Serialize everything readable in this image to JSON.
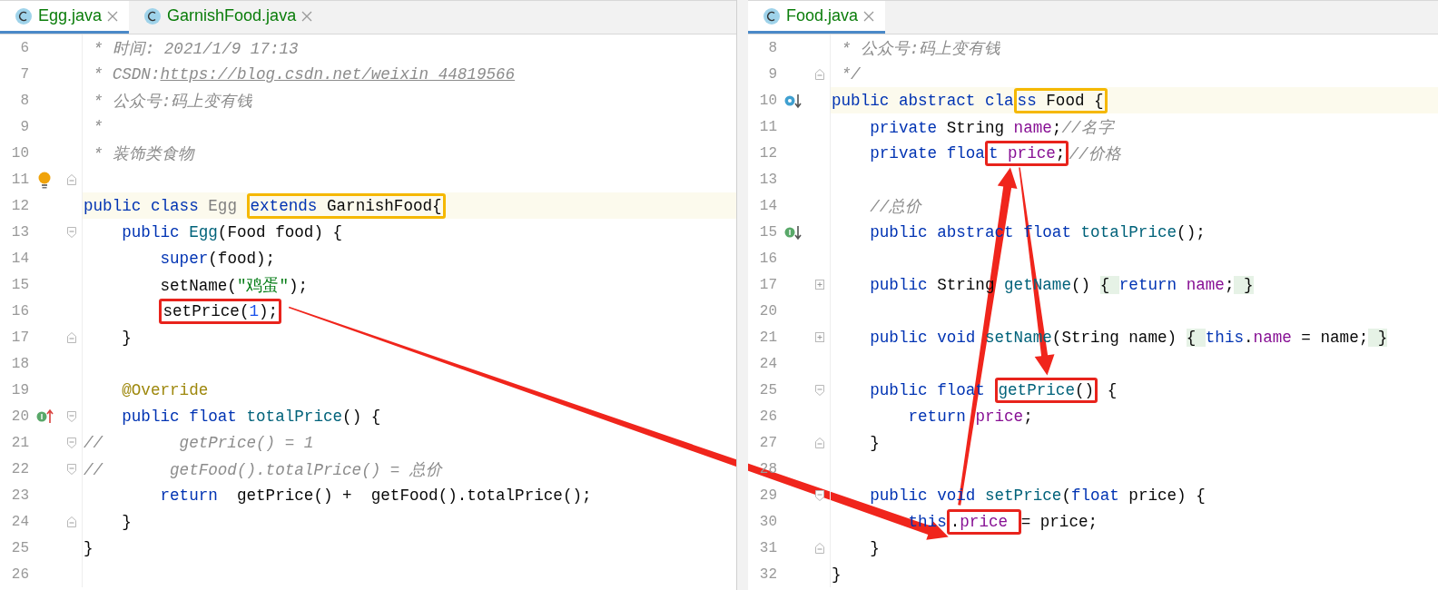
{
  "panes": [
    {
      "tabs": [
        {
          "label": "Egg.java",
          "selected": true
        },
        {
          "label": "GarnishFood.java",
          "selected": false
        }
      ],
      "lines": [
        {
          "number": "6",
          "tokens": [
            {
              "text": " * 时间: 2021/1/9 17:13",
              "kind": "comment"
            }
          ]
        },
        {
          "number": "7",
          "tokens": [
            {
              "text": " * CSDN:",
              "kind": "comment"
            },
            {
              "text": "https://blog.csdn.net/weixin_44819566",
              "kind": "link"
            }
          ]
        },
        {
          "number": "8",
          "tokens": [
            {
              "text": " * 公众号:码上变有钱",
              "kind": "comment"
            }
          ]
        },
        {
          "number": "9",
          "tokens": [
            {
              "text": " *",
              "kind": "comment"
            }
          ]
        },
        {
          "number": "10",
          "tokens": [
            {
              "text": " * 装饰类食物",
              "kind": "comment"
            }
          ]
        },
        {
          "number": "11",
          "kind": "bulbend"
        },
        {
          "number": "12",
          "current": true,
          "tokens": [
            {
              "text": "public class ",
              "kind": "keyword"
            },
            {
              "text": "Egg ",
              "kind": "unused"
            },
            {
              "kind": "box",
              "color": "#f5b800",
              "tokens": [
                {
                  "text": "extends ",
                  "kind": "keyword"
                },
                {
                  "text": "GarnishFood{",
                  "kind": "plain"
                }
              ]
            }
          ]
        },
        {
          "number": "13",
          "kind": "foldstart",
          "tokens": [
            {
              "text": "    public ",
              "kind": "keyword"
            },
            {
              "text": "Egg",
              "kind": "method"
            },
            {
              "text": "(Food food) {",
              "kind": "plain"
            }
          ]
        },
        {
          "number": "14",
          "tokens": [
            {
              "text": "        super",
              "kind": "keyword"
            },
            {
              "text": "(food);",
              "kind": "plain"
            }
          ]
        },
        {
          "number": "15",
          "tokens": [
            {
              "text": "        setName(",
              "kind": "plain"
            },
            {
              "text": "\"鸡蛋\"",
              "kind": "string"
            },
            {
              "text": ");",
              "kind": "plain"
            }
          ]
        },
        {
          "number": "16",
          "tokens": [
            {
              "kind": "box",
              "color": "#e8231c",
              "tokens": [
                {
                  "text": "setPrice(",
                  "kind": "plain"
                },
                {
                  "text": "1",
                  "kind": "number"
                },
                {
                  "text": ");",
                  "kind": "plain"
                }
              ]
            }
          ]
        },
        {
          "number": "17",
          "kind": "foldend",
          "tokens": [
            {
              "text": "    }",
              "kind": "plain"
            }
          ]
        },
        {
          "number": "18"
        },
        {
          "number": "19",
          "tokens": [
            {
              "text": "    @Override",
              "kind": "annotation"
            }
          ]
        },
        {
          "number": "20",
          "kind": "implementsstart",
          "tokens": [
            {
              "text": "    public float ",
              "kind": "keyword"
            },
            {
              "text": "totalPrice",
              "kind": "method"
            },
            {
              "text": "() {",
              "kind": "plain"
            }
          ]
        },
        {
          "number": "21",
          "kind": "foldstart",
          "tokens": [
            {
              "text": "//        getPrice() = 1",
              "kind": "comment"
            }
          ]
        },
        {
          "number": "22",
          "kind": "foldstart",
          "tokens": [
            {
              "text": "//       getFood().totalPrice() = 总价",
              "kind": "comment"
            }
          ]
        },
        {
          "number": "23",
          "tokens": [
            {
              "text": "        return ",
              "kind": "keyword"
            },
            {
              "text": " getPrice() +  getFood().totalPrice();",
              "kind": "plain"
            }
          ]
        },
        {
          "number": "24",
          "kind": "foldend",
          "tokens": [
            {
              "text": "    }",
              "kind": "plain"
            }
          ]
        },
        {
          "number": "25",
          "tokens": [
            {
              "text": "}",
              "kind": "plain"
            }
          ]
        },
        {
          "number": "26"
        }
      ]
    },
    {
      "tabs": [
        {
          "label": "Food.java",
          "selected": true
        }
      ],
      "lines": [
        {
          "number": "8",
          "tokens": [
            {
              "text": " * 公众号:码上变有钱",
              "kind": "comment"
            }
          ]
        },
        {
          "number": "9",
          "kind": "foldend",
          "tokens": [
            {
              "text": " */",
              "kind": "comment"
            }
          ]
        },
        {
          "number": "10",
          "kind": "overridden",
          "current": true,
          "tokens": [
            {
              "text": "public abstract cla",
              "kind": "keyword"
            },
            {
              "kind": "box",
              "color": "#f5b800",
              "tokens": [
                {
                  "text": "ss",
                  "kind": "keyword"
                },
                {
                  "text": " Food {",
                  "kind": "plain"
                }
              ]
            }
          ]
        },
        {
          "number": "11",
          "tokens": [
            {
              "text": "    private ",
              "kind": "keyword"
            },
            {
              "text": "String ",
              "kind": "plain"
            },
            {
              "text": "name",
              "kind": "field"
            },
            {
              "text": ";",
              "kind": "plain"
            },
            {
              "text": "//名字",
              "kind": "comment"
            }
          ]
        },
        {
          "number": "12",
          "tokens": [
            {
              "text": "    private floa",
              "kind": "keyword"
            },
            {
              "kind": "box",
              "color": "#e8231c",
              "tokens": [
                {
                  "text": "t",
                  "kind": "keyword"
                },
                {
                  "text": " price",
                  "kind": "field"
                },
                {
                  "text": ";",
                  "kind": "plain"
                }
              ]
            },
            {
              "text": "//价格",
              "kind": "comment"
            }
          ]
        },
        {
          "number": "13"
        },
        {
          "number": "14",
          "tokens": [
            {
              "text": "    //总价",
              "kind": "comment"
            }
          ]
        },
        {
          "number": "15",
          "kind": "implemented",
          "tokens": [
            {
              "text": "    public abstract float ",
              "kind": "keyword"
            },
            {
              "text": "totalPrice",
              "kind": "method"
            },
            {
              "text": "();",
              "kind": "plain"
            }
          ]
        },
        {
          "number": "16"
        },
        {
          "number": "17",
          "kind": "collapsed",
          "tokens": [
            {
              "text": "    public ",
              "kind": "keyword"
            },
            {
              "text": "String ",
              "kind": "plain"
            },
            {
              "text": "getName",
              "kind": "method"
            },
            {
              "text": "() ",
              "kind": "plain"
            },
            {
              "text": "{ ",
              "kind": "folded"
            },
            {
              "text": "return ",
              "kind": "keyword"
            },
            {
              "text": "name",
              "kind": "field"
            },
            {
              "text": ";",
              "kind": "plain"
            },
            {
              "text": " }",
              "kind": "folded"
            }
          ]
        },
        {
          "number": "20"
        },
        {
          "number": "21",
          "kind": "collapsed",
          "tokens": [
            {
              "text": "    public void ",
              "kind": "keyword"
            },
            {
              "text": "setName",
              "kind": "method"
            },
            {
              "text": "(String name) ",
              "kind": "plain"
            },
            {
              "text": "{ ",
              "kind": "folded"
            },
            {
              "text": "this",
              "kind": "keyword"
            },
            {
              "text": ".",
              "kind": "plain"
            },
            {
              "text": "name",
              "kind": "field"
            },
            {
              "text": " = name;",
              "kind": "plain"
            },
            {
              "text": " }",
              "kind": "folded"
            }
          ]
        },
        {
          "number": "24"
        },
        {
          "number": "25",
          "kind": "foldstart",
          "tokens": [
            {
              "text": "    public float ",
              "kind": "keyword"
            },
            {
              "kind": "box",
              "color": "#e8231c",
              "tokens": [
                {
                  "text": "getPrice",
                  "kind": "method"
                },
                {
                  "text": "()",
                  "kind": "plain"
                }
              ]
            },
            {
              "text": " {",
              "kind": "plain"
            }
          ]
        },
        {
          "number": "26",
          "tokens": [
            {
              "text": "        return ",
              "kind": "keyword"
            },
            {
              "text": "price",
              "kind": "field"
            },
            {
              "text": ";",
              "kind": "plain"
            }
          ]
        },
        {
          "number": "27",
          "kind": "foldend",
          "tokens": [
            {
              "text": "    }",
              "kind": "plain"
            }
          ]
        },
        {
          "number": "28"
        },
        {
          "number": "29",
          "kind": "foldstart",
          "tokens": [
            {
              "text": "    public void ",
              "kind": "keyword"
            },
            {
              "text": "setPrice",
              "kind": "method"
            },
            {
              "text": "(",
              "kind": "plain"
            },
            {
              "text": "float ",
              "kind": "keyword"
            },
            {
              "text": "price) {",
              "kind": "plain"
            }
          ]
        },
        {
          "number": "30",
          "tokens": [
            {
              "text": "        this",
              "kind": "keyword"
            },
            {
              "kind": "box",
              "color": "#e8231c",
              "tokens": [
                {
                  "text": ".",
                  "kind": "plain"
                },
                {
                  "text": "price ",
                  "kind": "field"
                }
              ]
            },
            {
              "text": "= price;",
              "kind": "plain"
            }
          ]
        },
        {
          "number": "31",
          "kind": "foldend",
          "tokens": [
            {
              "text": "    }",
              "kind": "plain"
            }
          ]
        },
        {
          "number": "32",
          "tokens": [
            {
              "text": "}",
              "kind": "plain"
            }
          ]
        }
      ]
    }
  ]
}
